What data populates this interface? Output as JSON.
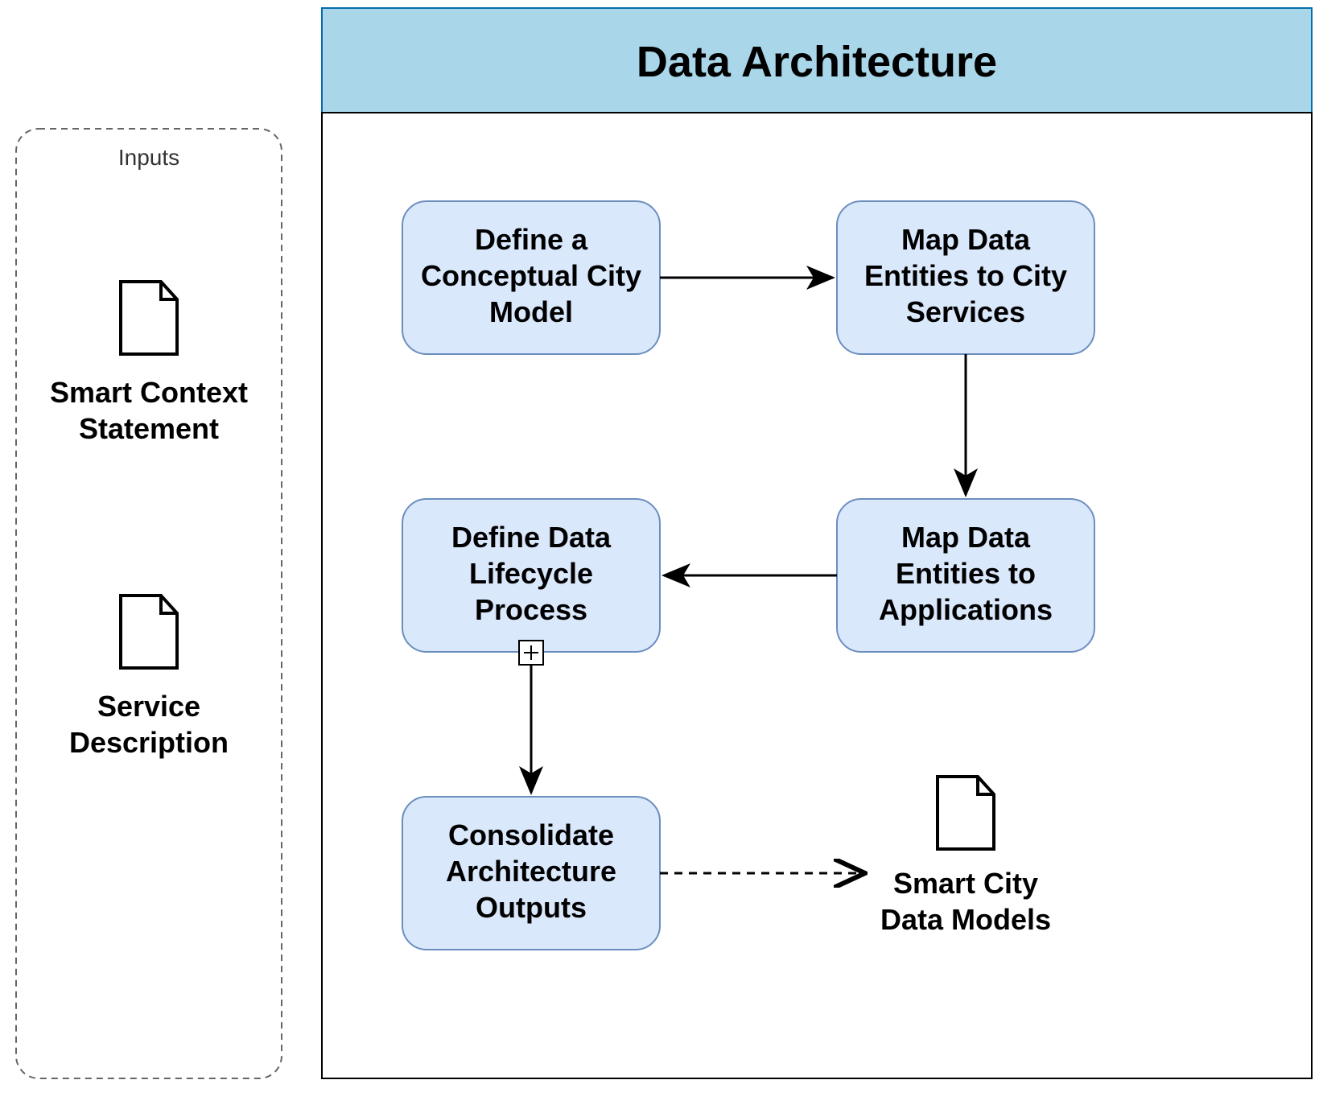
{
  "title": "Data Architecture",
  "inputs_section": {
    "label": "Inputs",
    "items": [
      {
        "caption_line1": "Smart Context",
        "caption_line2": "Statement"
      },
      {
        "caption_line1": "Service",
        "caption_line2": "Description"
      }
    ]
  },
  "flow_nodes": {
    "n1": {
      "line1": "Define a",
      "line2": "Conceptual City",
      "line3": "Model"
    },
    "n2": {
      "line1": "Map Data",
      "line2": "Entities to City",
      "line3": "Services"
    },
    "n3": {
      "line1": "Map Data",
      "line2": "Entities to",
      "line3": "Applications"
    },
    "n4": {
      "line1": "Define Data",
      "line2": "Lifecycle",
      "line3": "Process"
    },
    "n5": {
      "line1": "Consolidate",
      "line2": "Architecture",
      "line3": "Outputs"
    }
  },
  "output": {
    "caption_line1": "Smart City",
    "caption_line2": "Data Models"
  },
  "colors": {
    "header_fill": "#A9D6E8",
    "header_stroke": "#036EAB",
    "node_fill": "#DAE8FC",
    "node_stroke": "#6C8EBF",
    "dashed_stroke": "#666666"
  }
}
